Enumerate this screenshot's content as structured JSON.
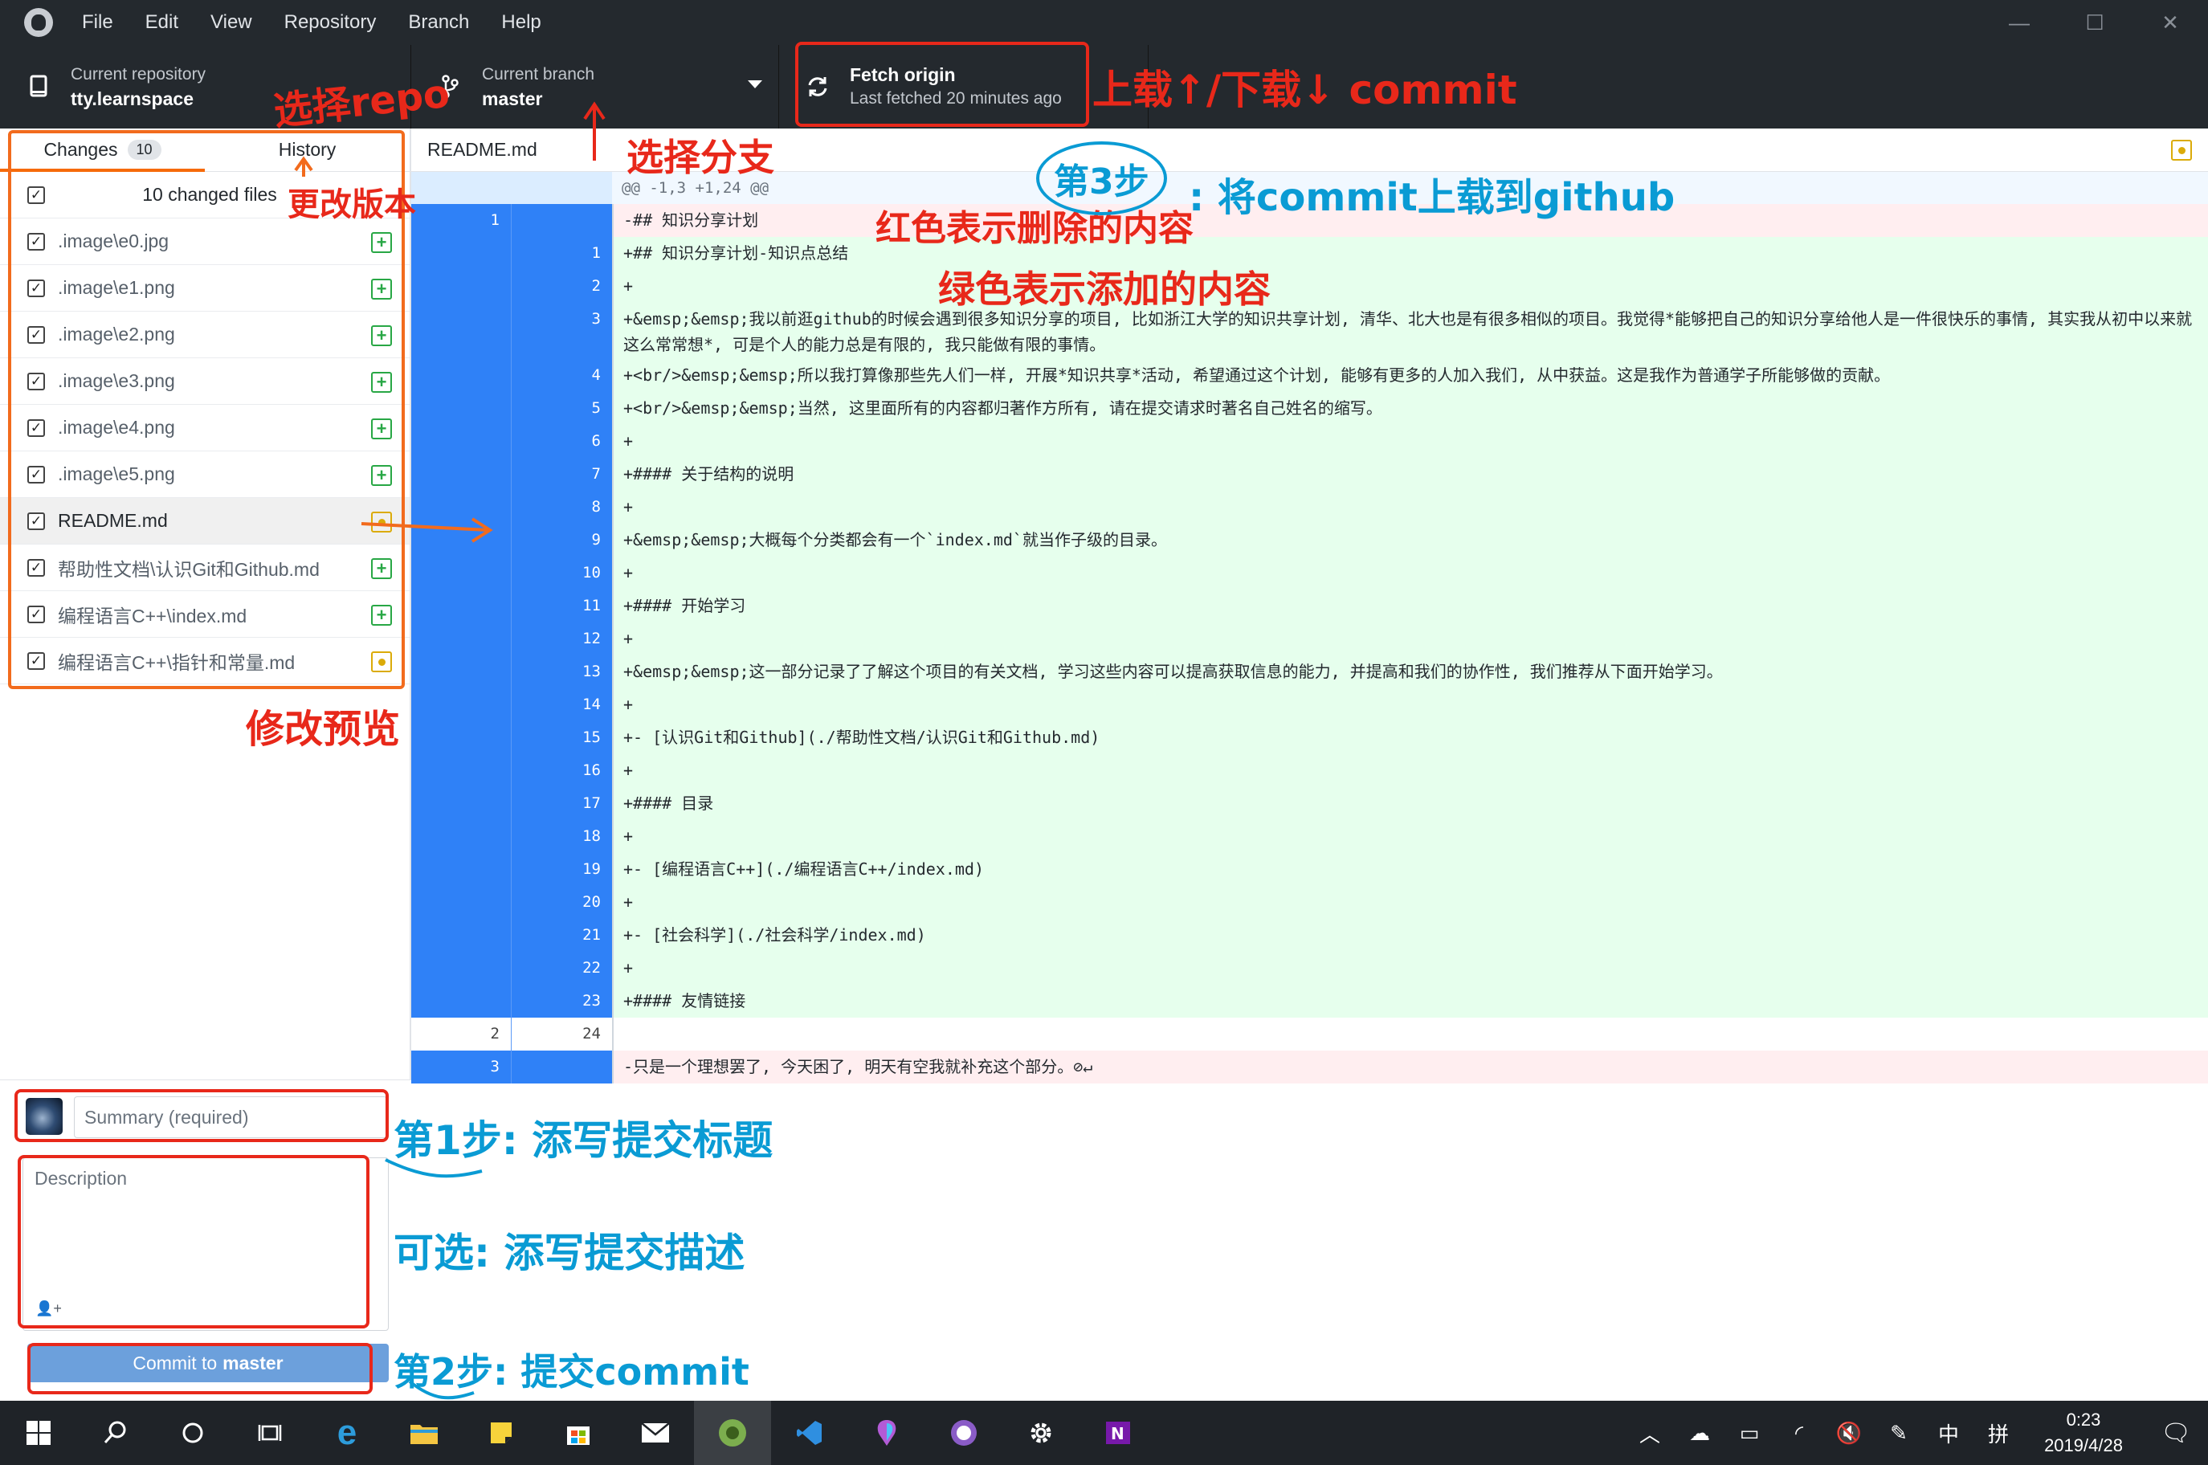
{
  "titlebar": {
    "menu": [
      "File",
      "Edit",
      "View",
      "Repository",
      "Branch",
      "Help"
    ],
    "controls": [
      "—",
      "☐",
      "✕"
    ]
  },
  "toolbar": {
    "repo_label": "Current repository",
    "repo_value": "tty.learnspace",
    "branch_label": "Current branch",
    "branch_value": "master",
    "fetch_label": "Fetch origin",
    "fetch_sub": "Last fetched 20 minutes ago"
  },
  "sidebar": {
    "tab_changes": "Changes",
    "changes_count": "10",
    "tab_history": "History",
    "changed_files_label": "10 changed files",
    "files": [
      {
        "name": ".image\\e0.jpg",
        "status": "added"
      },
      {
        "name": ".image\\e1.png",
        "status": "added"
      },
      {
        "name": ".image\\e2.png",
        "status": "added"
      },
      {
        "name": ".image\\e3.png",
        "status": "added"
      },
      {
        "name": ".image\\e4.png",
        "status": "added"
      },
      {
        "name": ".image\\e5.png",
        "status": "added"
      },
      {
        "name": "README.md",
        "status": "modified"
      },
      {
        "name": "帮助性文档\\认识Git和Github.md",
        "status": "added"
      },
      {
        "name": "编程语言C++\\index.md",
        "status": "added"
      },
      {
        "name": "编程语言C++\\指针和常量.md",
        "status": "modified"
      }
    ]
  },
  "commit": {
    "summary_placeholder": "Summary (required)",
    "description_placeholder": "Description",
    "button_prefix": "Commit to",
    "button_branch": "master"
  },
  "diff": {
    "file": "README.md",
    "hunk": "@@ -1,3 +1,24 @@",
    "lines": [
      {
        "type": "del",
        "old": "1",
        "new": "",
        "text": "-## 知识分享计划"
      },
      {
        "type": "add",
        "old": "",
        "new": "1",
        "text": "+## 知识分享计划-知识点总结"
      },
      {
        "type": "add",
        "old": "",
        "new": "2",
        "text": "+"
      },
      {
        "type": "add",
        "old": "",
        "new": "3",
        "text": "+&emsp;&emsp;我以前逛github的时候会遇到很多知识分享的项目, 比如浙江大学的知识共享计划, 清华、北大也是有很多相似的项目。我觉得*能够把自己的知识分享给他人是一件很快乐的事情, 其实我从初中以来就这么常常想*, 可是个人的能力总是有限的, 我只能做有限的事情。"
      },
      {
        "type": "add",
        "old": "",
        "new": "4",
        "text": "+<br/>&emsp;&emsp;所以我打算像那些先人们一样, 开展*知识共享*活动, 希望通过这个计划, 能够有更多的人加入我们, 从中获益。这是我作为普通学子所能够做的贡献。"
      },
      {
        "type": "add",
        "old": "",
        "new": "5",
        "text": "+<br/>&emsp;&emsp;当然, 这里面所有的内容都归著作方所有, 请在提交请求时著名自己姓名的缩写。"
      },
      {
        "type": "add",
        "old": "",
        "new": "6",
        "text": "+"
      },
      {
        "type": "add",
        "old": "",
        "new": "7",
        "text": "+#### 关于结构的说明"
      },
      {
        "type": "add",
        "old": "",
        "new": "8",
        "text": "+"
      },
      {
        "type": "add",
        "old": "",
        "new": "9",
        "text": "+&emsp;&emsp;大概每个分类都会有一个`index.md`就当作子级的目录。"
      },
      {
        "type": "add",
        "old": "",
        "new": "10",
        "text": "+"
      },
      {
        "type": "add",
        "old": "",
        "new": "11",
        "text": "+#### 开始学习"
      },
      {
        "type": "add",
        "old": "",
        "new": "12",
        "text": "+"
      },
      {
        "type": "add",
        "old": "",
        "new": "13",
        "text": "+&emsp;&emsp;这一部分记录了了解这个项目的有关文档, 学习这些内容可以提高获取信息的能力, 并提高和我们的协作性, 我们推荐从下面开始学习。"
      },
      {
        "type": "add",
        "old": "",
        "new": "14",
        "text": "+"
      },
      {
        "type": "add",
        "old": "",
        "new": "15",
        "text": "+- [认识Git和Github](./帮助性文档/认识Git和Github.md)"
      },
      {
        "type": "add",
        "old": "",
        "new": "16",
        "text": "+"
      },
      {
        "type": "add",
        "old": "",
        "new": "17",
        "text": "+#### 目录"
      },
      {
        "type": "add",
        "old": "",
        "new": "18",
        "text": "+"
      },
      {
        "type": "add",
        "old": "",
        "new": "19",
        "text": "+- [编程语言C++](./编程语言C++/index.md)"
      },
      {
        "type": "add",
        "old": "",
        "new": "20",
        "text": "+"
      },
      {
        "type": "add",
        "old": "",
        "new": "21",
        "text": "+- [社会科学](./社会科学/index.md)"
      },
      {
        "type": "add",
        "old": "",
        "new": "22",
        "text": "+"
      },
      {
        "type": "add",
        "old": "",
        "new": "23",
        "text": "+#### 友情链接"
      },
      {
        "type": "ctx",
        "old": "2",
        "new": "24",
        "text": ""
      },
      {
        "type": "del",
        "old": "3",
        "new": "",
        "text": "-只是一个理想罢了, 今天困了, 明天有空我就补充这个部分。⊘↵"
      }
    ]
  },
  "annotations": {
    "select_repo": "选择repo",
    "select_branch": "选择分支",
    "pull_push": "上载↑/下载↓ commit",
    "change_version": "更改版本",
    "step3": "第3步",
    "step3_text": ": 将commit上载到github",
    "red_meaning": "红色表示删除的内容",
    "green_meaning": "绿色表示添加的内容",
    "preview_changes": "修改预览",
    "step1": "第1步: 添写提交标题",
    "optional": "可选: 添写提交描述",
    "step2": "第2步: 提交commit"
  },
  "taskbar": {
    "time": "0:23",
    "date": "2019/4/28",
    "ime": "中",
    "ime2": "拼"
  },
  "colors": {
    "accent_orange": "#f66a0a",
    "add_bg": "#e6ffed",
    "del_bg": "#ffeef0",
    "gutter_blue": "#2f81f7",
    "annotation_red": "#e8281a",
    "annotation_blue": "#0a9bd4"
  }
}
